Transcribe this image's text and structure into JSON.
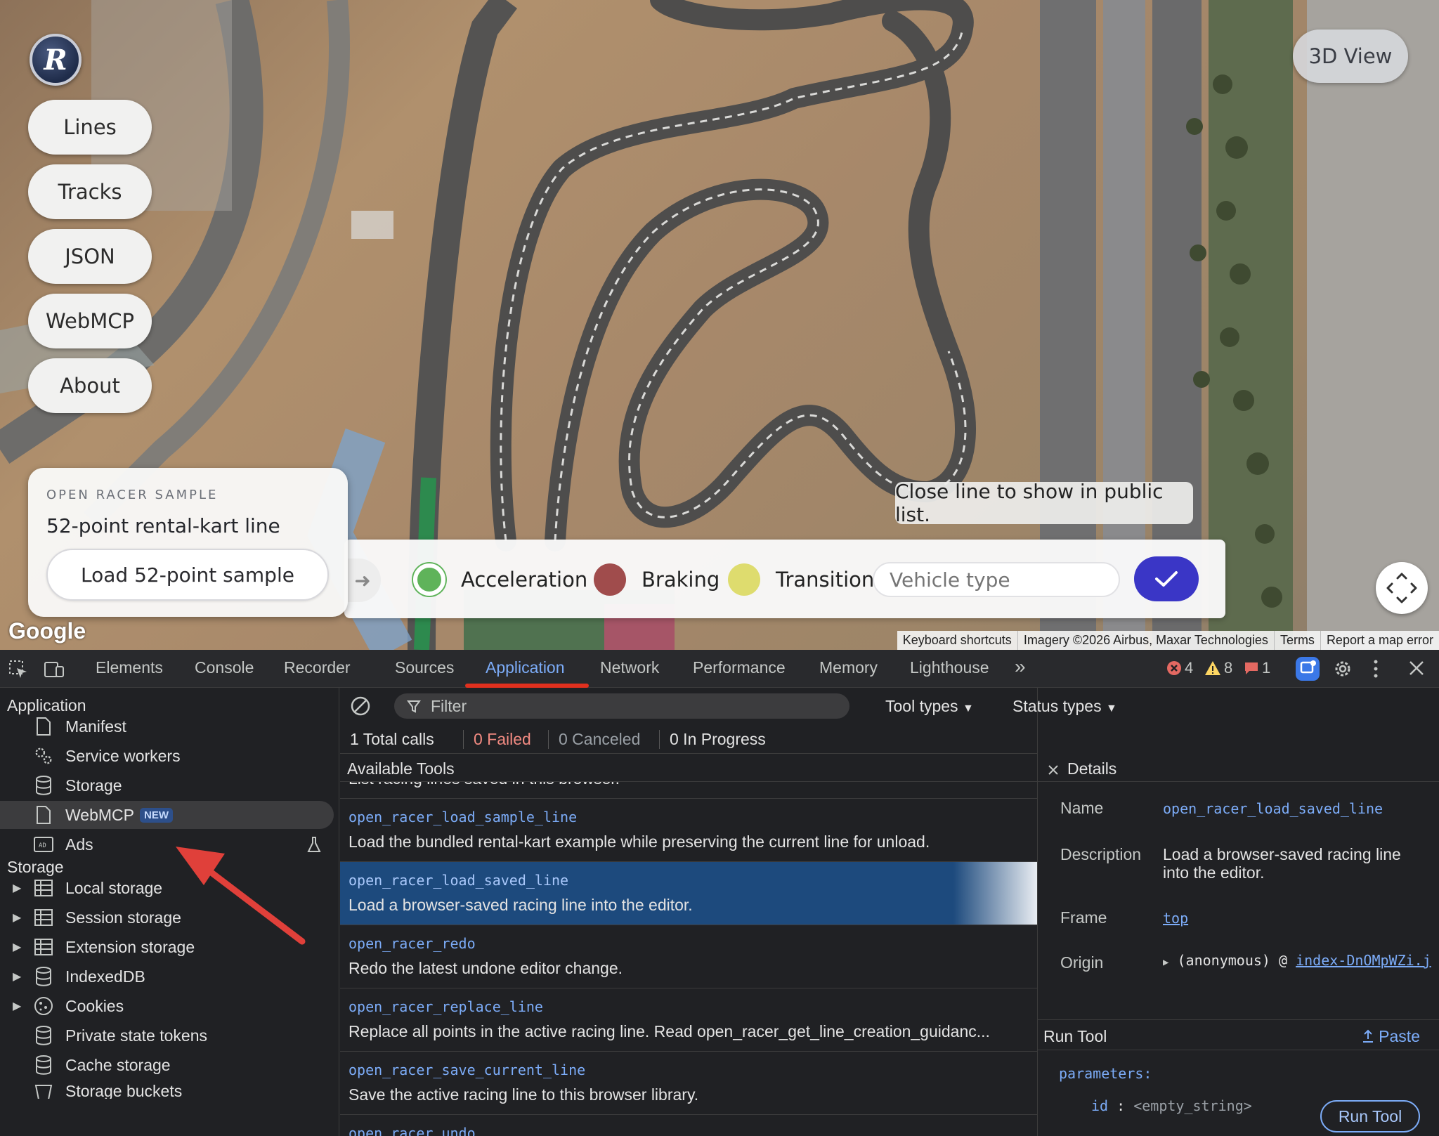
{
  "app": {
    "logo_letter": "R",
    "nav": [
      "Lines",
      "Tracks",
      "JSON",
      "WebMCP",
      "About"
    ],
    "view_toggle": "3D View",
    "sample_card": {
      "eyebrow": "OPEN RACER SAMPLE",
      "title": "52-point rental-kart line",
      "button": "Load 52-point sample"
    },
    "legend": [
      {
        "label": "Acceleration",
        "color": "#5fb35a"
      },
      {
        "label": "Braking",
        "color": "#a04c4c"
      },
      {
        "label": "Transition",
        "color": "#dedc6e"
      }
    ],
    "vehicle_placeholder": "Vehicle type",
    "toast": "Close line to show in public list.",
    "map_attribution": {
      "google": "Google",
      "items": [
        "Keyboard shortcuts",
        "Imagery ©2026 Airbus, Maxar Technologies",
        "Terms",
        "Report a map error"
      ]
    },
    "accent_color": "#3a36c6"
  },
  "devtools": {
    "tabs": [
      "Elements",
      "Console",
      "Recorder",
      "Sources",
      "Application",
      "Network",
      "Performance",
      "Memory",
      "Lighthouse"
    ],
    "active_tab": "Application",
    "more_tabs": "»",
    "status": {
      "errors": "4",
      "warnings": "8",
      "issues": "1"
    },
    "sidebar": {
      "application_heading": "Application",
      "application_items": [
        {
          "label": "Manifest",
          "icon": "file-icon"
        },
        {
          "label": "Service workers",
          "icon": "gears-icon"
        },
        {
          "label": "Storage",
          "icon": "database-icon"
        },
        {
          "label": "WebMCP",
          "icon": "file-icon",
          "badge": "NEW"
        },
        {
          "label": "Ads",
          "icon": "ad-icon"
        }
      ],
      "storage_heading": "Storage",
      "storage_items": [
        {
          "label": "Local storage",
          "icon": "table-icon"
        },
        {
          "label": "Session storage",
          "icon": "table-icon"
        },
        {
          "label": "Extension storage",
          "icon": "table-icon"
        },
        {
          "label": "IndexedDB",
          "icon": "database-icon"
        },
        {
          "label": "Cookies",
          "icon": "cookie-icon"
        },
        {
          "label": "Private state tokens",
          "icon": "database-icon"
        },
        {
          "label": "Cache storage",
          "icon": "database-icon"
        },
        {
          "label": "Storage buckets",
          "icon": "bucket-icon"
        }
      ]
    },
    "filter_placeholder": "Filter",
    "tool_types": "Tool types",
    "status_types": "Status types",
    "stats": {
      "total": "1 Total calls",
      "failed": "0 Failed",
      "canceled": "0 Canceled",
      "in_progress": "0 In Progress"
    },
    "tools_heading": "Available Tools",
    "tools_clipped_top": "List racing lines saved in this browser.",
    "tools": [
      {
        "name": "open_racer_load_sample_line",
        "desc": "Load the bundled rental-kart example while preserving the current line for unload."
      },
      {
        "name": "open_racer_load_saved_line",
        "desc": "Load a browser-saved racing line into the editor."
      },
      {
        "name": "open_racer_redo",
        "desc": "Redo the latest undone editor change."
      },
      {
        "name": "open_racer_replace_line",
        "desc": "Replace all points in the active racing line. Read open_racer_get_line_creation_guidanc..."
      },
      {
        "name": "open_racer_save_current_line",
        "desc": "Save the active racing line to this browser library."
      },
      {
        "name": "open_racer_undo",
        "desc": ""
      }
    ],
    "details": {
      "heading": "Details",
      "name_label": "Name",
      "name_value": "open_racer_load_saved_line",
      "description_label": "Description",
      "description_value_1": "Load a browser-saved racing line",
      "description_value_2": "into the editor.",
      "frame_label": "Frame",
      "frame_value": "top",
      "origin_label": "Origin",
      "origin_value": "(anonymous) @",
      "origin_link": "index-DnOMpWZi.j",
      "run_tool_heading": "Run Tool",
      "paste": "Paste",
      "parameters_label": "parameters:",
      "param_key": "id",
      "param_sep": " : ",
      "param_value": "<empty_string>",
      "run_button": "Run Tool"
    }
  }
}
